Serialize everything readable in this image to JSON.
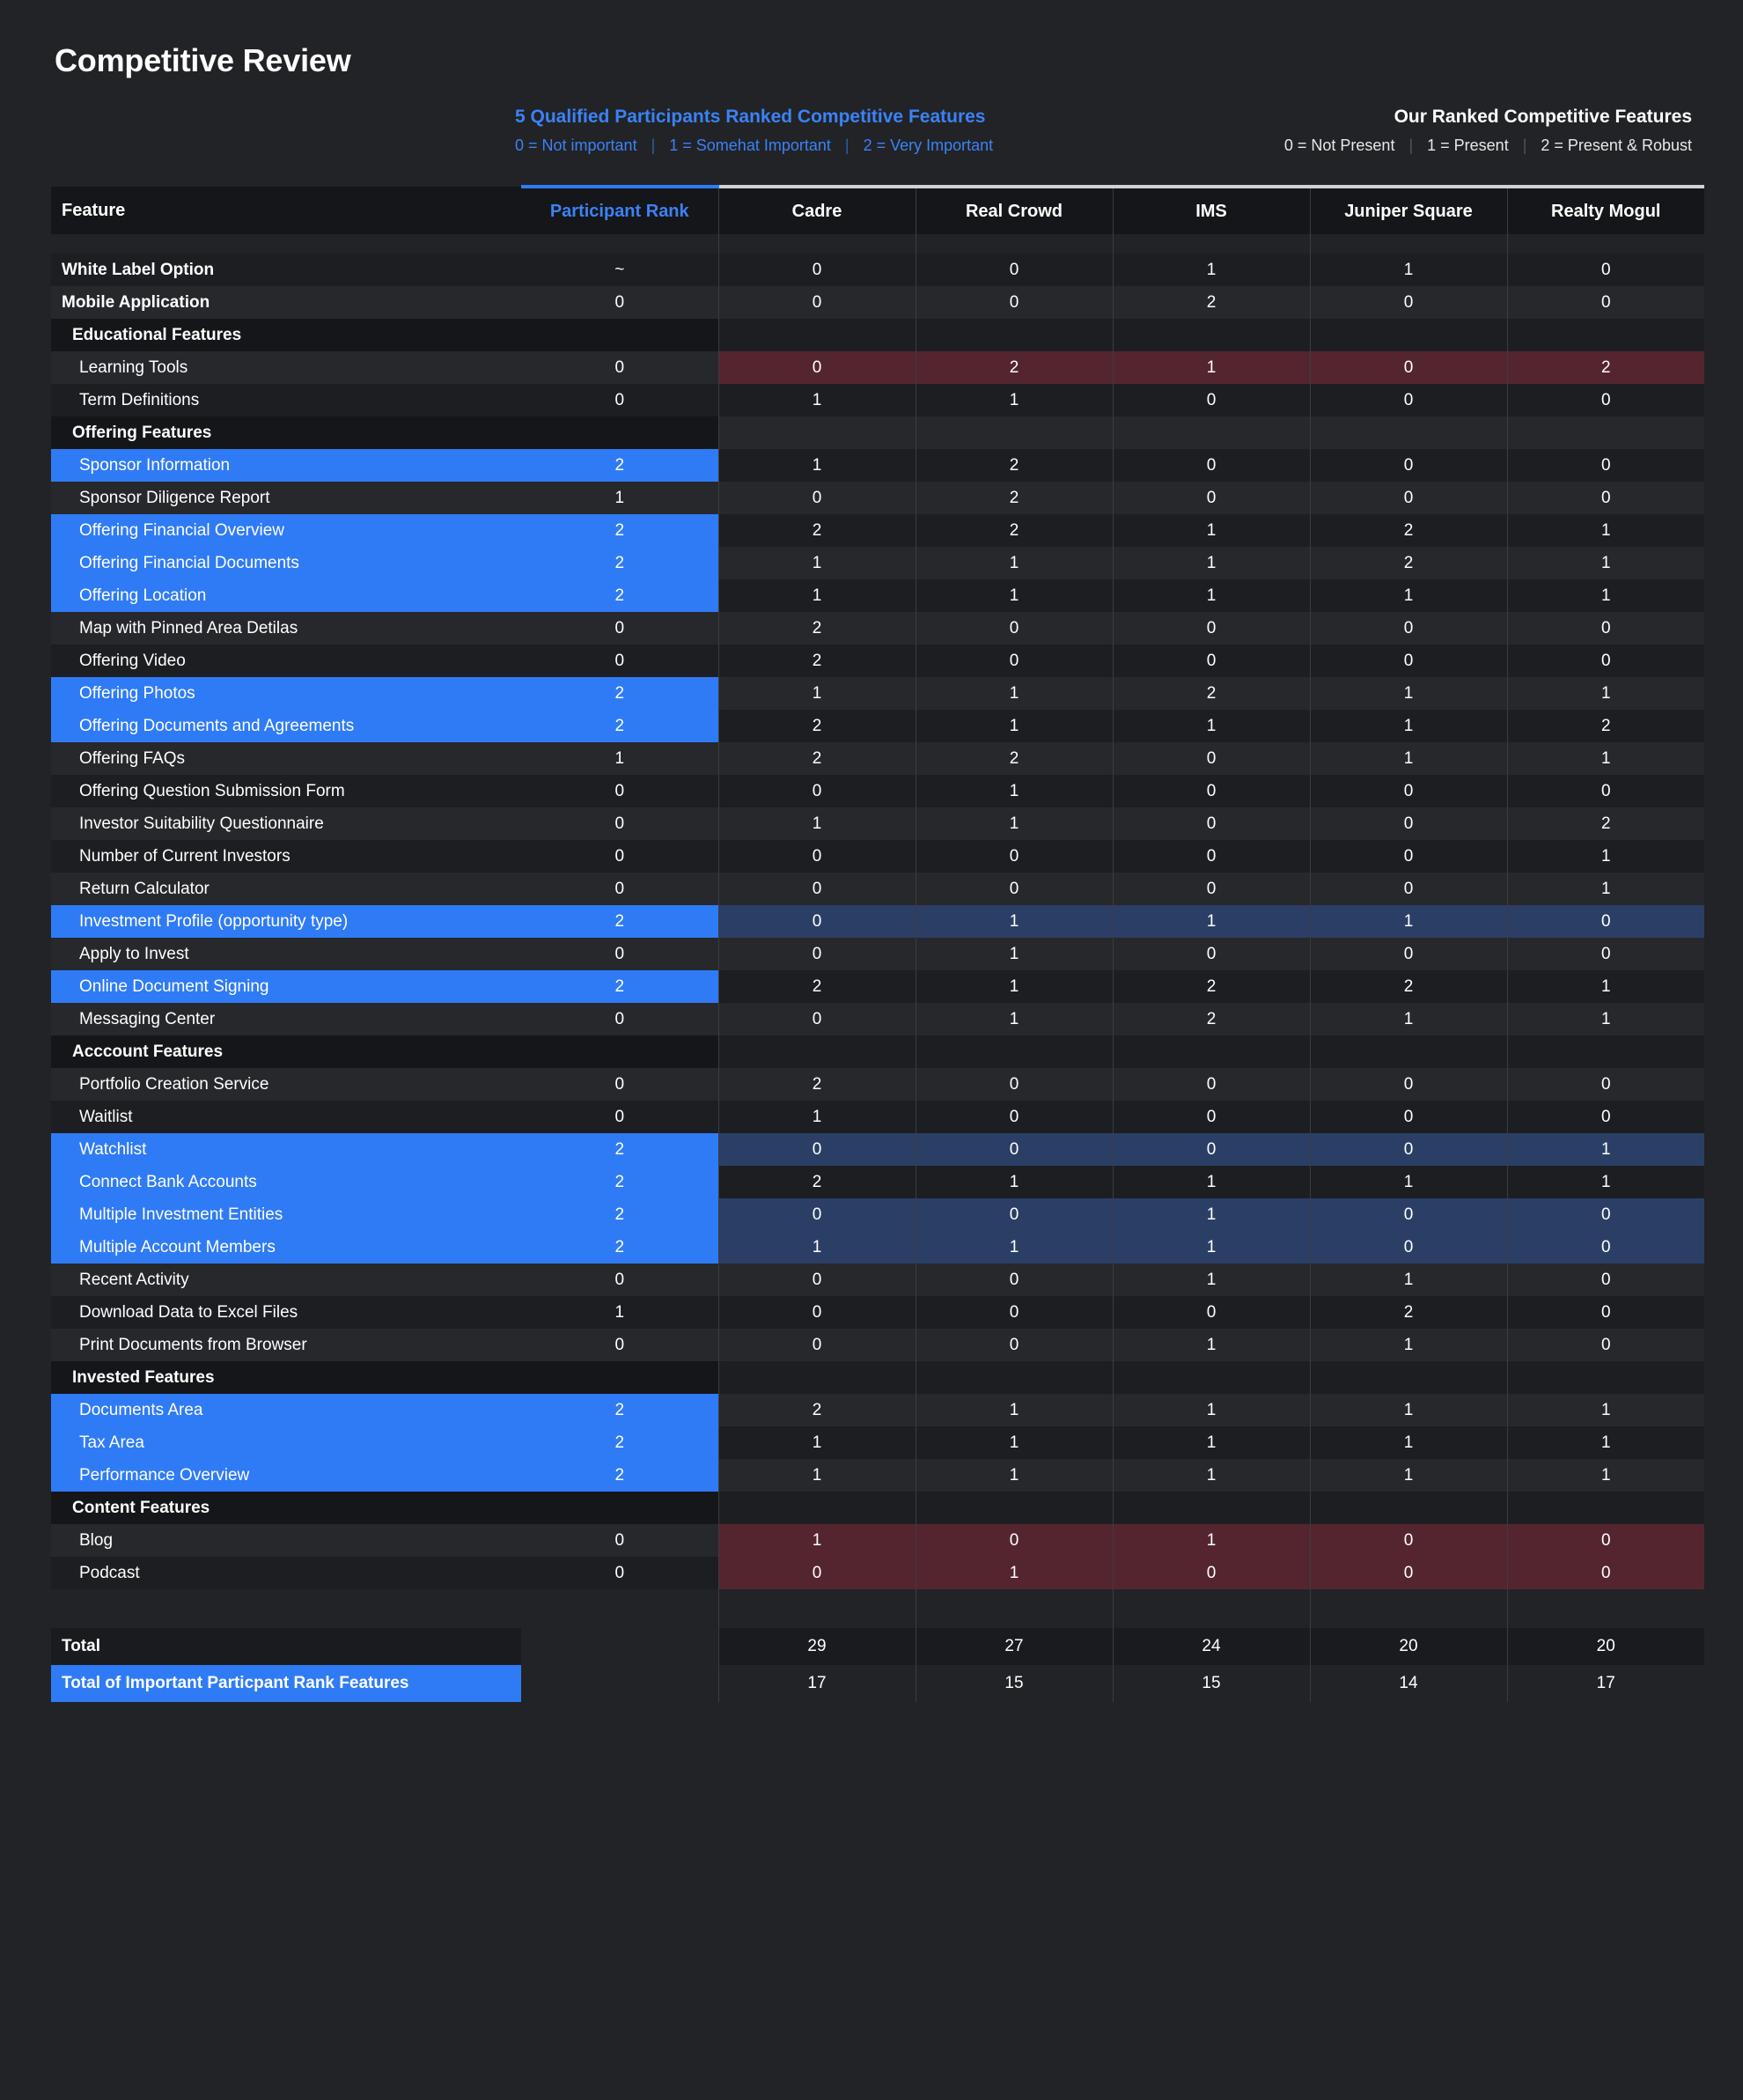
{
  "page_title": "Competitive Review",
  "legend": {
    "left": {
      "heading": "5 Qualified Participants Ranked Competitive Features",
      "item0": "0 = Not important",
      "item1": "1 = Somehat Important",
      "item2": "2 = Very Important"
    },
    "right": {
      "heading": "Our Ranked Competitive Features",
      "item0": "0 = Not Present",
      "item1": "1 = Present",
      "item2": "2 = Present & Robust"
    }
  },
  "colors": {
    "accent_blue": "#2f7bf6",
    "text_blue": "#3b82f6",
    "highlight_row_blue": "#2b3f66",
    "highlight_row_red": "#55252f",
    "page_bg": "#222326"
  },
  "columns": {
    "feature": "Feature",
    "rank": "Participant Rank",
    "vendors": [
      "Cadre",
      "Real Crowd",
      "IMS",
      "Juniper Square",
      "Realty Mogul"
    ]
  },
  "rows": [
    {
      "label": "White Label Option",
      "kind": "toplevel",
      "rank": "~",
      "values": [
        "0",
        "0",
        "1",
        "1",
        "0"
      ],
      "highlight": "none"
    },
    {
      "label": "Mobile Application",
      "kind": "toplevel",
      "rank": "0",
      "values": [
        "0",
        "0",
        "2",
        "0",
        "0"
      ],
      "highlight": "none"
    },
    {
      "label": "Educational Features",
      "kind": "group",
      "rank": "",
      "values": [
        "",
        "",
        "",
        "",
        ""
      ],
      "highlight": "none"
    },
    {
      "label": "Learning Tools",
      "kind": "item",
      "rank": "0",
      "values": [
        "0",
        "2",
        "1",
        "0",
        "2"
      ],
      "highlight": "red"
    },
    {
      "label": "Term Definitions",
      "kind": "item",
      "rank": "0",
      "values": [
        "1",
        "1",
        "0",
        "0",
        "0"
      ],
      "highlight": "none"
    },
    {
      "label": "Offering Features",
      "kind": "group",
      "rank": "",
      "values": [
        "",
        "",
        "",
        "",
        ""
      ],
      "highlight": "none"
    },
    {
      "label": "Sponsor Information",
      "kind": "item",
      "rank": "2",
      "values": [
        "1",
        "2",
        "0",
        "0",
        "0"
      ],
      "highlight": "blue-label"
    },
    {
      "label": "Sponsor Diligence Report",
      "kind": "item",
      "rank": "1",
      "values": [
        "0",
        "2",
        "0",
        "0",
        "0"
      ],
      "highlight": "none"
    },
    {
      "label": "Offering Financial Overview",
      "kind": "item",
      "rank": "2",
      "values": [
        "2",
        "2",
        "1",
        "2",
        "1"
      ],
      "highlight": "blue-label"
    },
    {
      "label": "Offering Financial Documents",
      "kind": "item",
      "rank": "2",
      "values": [
        "1",
        "1",
        "1",
        "2",
        "1"
      ],
      "highlight": "blue-label"
    },
    {
      "label": "Offering Location",
      "kind": "item",
      "rank": "2",
      "values": [
        "1",
        "1",
        "1",
        "1",
        "1"
      ],
      "highlight": "blue-label"
    },
    {
      "label": "Map with Pinned Area Detilas",
      "kind": "item",
      "rank": "0",
      "values": [
        "2",
        "0",
        "0",
        "0",
        "0"
      ],
      "highlight": "none"
    },
    {
      "label": "Offering Video",
      "kind": "item",
      "rank": "0",
      "values": [
        "2",
        "0",
        "0",
        "0",
        "0"
      ],
      "highlight": "none"
    },
    {
      "label": "Offering Photos",
      "kind": "item",
      "rank": "2",
      "values": [
        "1",
        "1",
        "2",
        "1",
        "1"
      ],
      "highlight": "blue-label"
    },
    {
      "label": "Offering Documents and Agreements",
      "kind": "item",
      "rank": "2",
      "values": [
        "2",
        "1",
        "1",
        "1",
        "2"
      ],
      "highlight": "blue-label"
    },
    {
      "label": "Offering FAQs",
      "kind": "item",
      "rank": "1",
      "values": [
        "2",
        "2",
        "0",
        "1",
        "1"
      ],
      "highlight": "none"
    },
    {
      "label": "Offering Question Submission Form",
      "kind": "item",
      "rank": "0",
      "values": [
        "0",
        "1",
        "0",
        "0",
        "0"
      ],
      "highlight": "none"
    },
    {
      "label": "Investor Suitability Questionnaire",
      "kind": "item",
      "rank": "0",
      "values": [
        "1",
        "1",
        "0",
        "0",
        "2"
      ],
      "highlight": "none"
    },
    {
      "label": "Number of Current Investors",
      "kind": "item",
      "rank": "0",
      "values": [
        "0",
        "0",
        "0",
        "0",
        "1"
      ],
      "highlight": "none"
    },
    {
      "label": "Return Calculator",
      "kind": "item",
      "rank": "0",
      "values": [
        "0",
        "0",
        "0",
        "0",
        "1"
      ],
      "highlight": "none"
    },
    {
      "label": "Investment Profile (opportunity type)",
      "kind": "item",
      "rank": "2",
      "values": [
        "0",
        "1",
        "1",
        "1",
        "0"
      ],
      "highlight": "blue-row"
    },
    {
      "label": "Apply to Invest",
      "kind": "item",
      "rank": "0",
      "values": [
        "0",
        "1",
        "0",
        "0",
        "0"
      ],
      "highlight": "none"
    },
    {
      "label": "Online Document Signing",
      "kind": "item",
      "rank": "2",
      "values": [
        "2",
        "1",
        "2",
        "2",
        "1"
      ],
      "highlight": "blue-label"
    },
    {
      "label": "Messaging Center",
      "kind": "item",
      "rank": "0",
      "values": [
        "0",
        "1",
        "2",
        "1",
        "1"
      ],
      "highlight": "none"
    },
    {
      "label": "Acccount Features",
      "kind": "group",
      "rank": "",
      "values": [
        "",
        "",
        "",
        "",
        ""
      ],
      "highlight": "none"
    },
    {
      "label": "Portfolio Creation Service",
      "kind": "item",
      "rank": "0",
      "values": [
        "2",
        "0",
        "0",
        "0",
        "0"
      ],
      "highlight": "none"
    },
    {
      "label": "Waitlist",
      "kind": "item",
      "rank": "0",
      "values": [
        "1",
        "0",
        "0",
        "0",
        "0"
      ],
      "highlight": "none"
    },
    {
      "label": "Watchlist",
      "kind": "item",
      "rank": "2",
      "values": [
        "0",
        "0",
        "0",
        "0",
        "1"
      ],
      "highlight": "blue-row"
    },
    {
      "label": "Connect Bank Accounts",
      "kind": "item",
      "rank": "2",
      "values": [
        "2",
        "1",
        "1",
        "1",
        "1"
      ],
      "highlight": "blue-label"
    },
    {
      "label": "Multiple Investment Entities",
      "kind": "item",
      "rank": "2",
      "values": [
        "0",
        "0",
        "1",
        "0",
        "0"
      ],
      "highlight": "blue-row"
    },
    {
      "label": "Multiple Account Members",
      "kind": "item",
      "rank": "2",
      "values": [
        "1",
        "1",
        "1",
        "0",
        "0"
      ],
      "highlight": "blue-row"
    },
    {
      "label": "Recent Activity",
      "kind": "item",
      "rank": "0",
      "values": [
        "0",
        "0",
        "1",
        "1",
        "0"
      ],
      "highlight": "none"
    },
    {
      "label": "Download Data to Excel Files",
      "kind": "item",
      "rank": "1",
      "values": [
        "0",
        "0",
        "0",
        "2",
        "0"
      ],
      "highlight": "none"
    },
    {
      "label": "Print Documents from Browser",
      "kind": "item",
      "rank": "0",
      "values": [
        "0",
        "0",
        "1",
        "1",
        "0"
      ],
      "highlight": "none"
    },
    {
      "label": "Invested Features",
      "kind": "group",
      "rank": "",
      "values": [
        "",
        "",
        "",
        "",
        ""
      ],
      "highlight": "none"
    },
    {
      "label": "Documents Area",
      "kind": "item",
      "rank": "2",
      "values": [
        "2",
        "1",
        "1",
        "1",
        "1"
      ],
      "highlight": "blue-label"
    },
    {
      "label": "Tax Area",
      "kind": "item",
      "rank": "2",
      "values": [
        "1",
        "1",
        "1",
        "1",
        "1"
      ],
      "highlight": "blue-label"
    },
    {
      "label": "Performance Overview",
      "kind": "item",
      "rank": "2",
      "values": [
        "1",
        "1",
        "1",
        "1",
        "1"
      ],
      "highlight": "blue-label"
    },
    {
      "label": "Content Features",
      "kind": "group",
      "rank": "",
      "values": [
        "",
        "",
        "",
        "",
        ""
      ],
      "highlight": "none"
    },
    {
      "label": "Blog",
      "kind": "item",
      "rank": "0",
      "values": [
        "1",
        "0",
        "1",
        "0",
        "0"
      ],
      "highlight": "red"
    },
    {
      "label": "Podcast",
      "kind": "item",
      "rank": "0",
      "values": [
        "0",
        "1",
        "0",
        "0",
        "0"
      ],
      "highlight": "red"
    }
  ],
  "totals": {
    "total_label": "Total",
    "total_values": [
      "29",
      "27",
      "24",
      "20",
      "20"
    ],
    "important_label": "Total of Important Particpant Rank Features",
    "important_values": [
      "17",
      "15",
      "15",
      "14",
      "17"
    ]
  }
}
